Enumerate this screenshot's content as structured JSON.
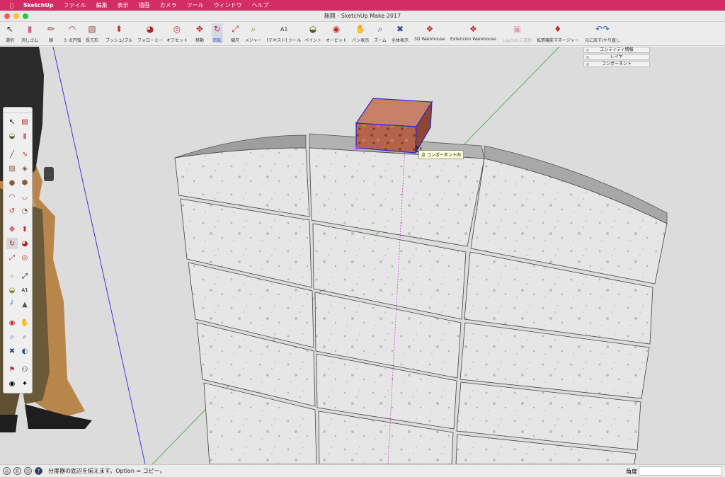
{
  "menubar": {
    "apple": "",
    "app_name": "SketchUp",
    "items": [
      "ファイル",
      "編集",
      "表示",
      "描画",
      "カメラ",
      "ツール",
      "ウィンドウ",
      "ヘルプ"
    ]
  },
  "window": {
    "title": "無題 - SketchUp Make 2017"
  },
  "toolbar": {
    "items": [
      {
        "label": "選択",
        "icon": "select-arrow-icon"
      },
      {
        "label": "消しゴム",
        "icon": "eraser-icon"
      },
      {
        "label": "線",
        "icon": "pencil-line-icon"
      },
      {
        "label": "３ 点円弧",
        "icon": "arc-icon"
      },
      {
        "label": "長方形",
        "icon": "rectangle-icon"
      },
      {
        "label": "プッシュ/プル",
        "icon": "push-pull-icon"
      },
      {
        "label": "フォローミー",
        "icon": "follow-me-icon"
      },
      {
        "label": "オフセット",
        "icon": "offset-icon"
      },
      {
        "label": "移動",
        "icon": "move-icon"
      },
      {
        "label": "回転",
        "icon": "rotate-icon"
      },
      {
        "label": "縮尺",
        "icon": "scale-icon"
      },
      {
        "label": "メジャー",
        "icon": "tape-measure-icon"
      },
      {
        "label": "[テキスト] ツール",
        "icon": "text-tool-icon"
      },
      {
        "label": "ペイント",
        "icon": "paint-bucket-icon"
      },
      {
        "label": "オービット",
        "icon": "orbit-icon"
      },
      {
        "label": "パン表示",
        "icon": "pan-hand-icon"
      },
      {
        "label": "ズーム",
        "icon": "zoom-icon"
      },
      {
        "label": "全体表示",
        "icon": "zoom-extents-icon"
      },
      {
        "label": "3D Warehouse",
        "icon": "warehouse-icon"
      },
      {
        "label": "Extension Warehouse",
        "icon": "extension-warehouse-icon"
      },
      {
        "label": "LayOut に送信",
        "icon": "layout-send-icon"
      },
      {
        "label": "拡張機能マネージャー",
        "icon": "extension-manager-icon"
      },
      {
        "label": "元に戻す/やり直し",
        "icon": "undo-redo-icon"
      }
    ]
  },
  "trays": [
    "エンティティ情報",
    "レイヤ",
    "コンポーネント"
  ],
  "tooltip": "点 コンポーネント内",
  "status": {
    "message": "分度器の底辺を揃えます。Option = コピー。",
    "measure_label": "角度",
    "measure_value": ""
  },
  "colors": {
    "menubar": "#d42c64",
    "accent_red": "#c8202a",
    "selection_blue": "#2a2ad0"
  }
}
